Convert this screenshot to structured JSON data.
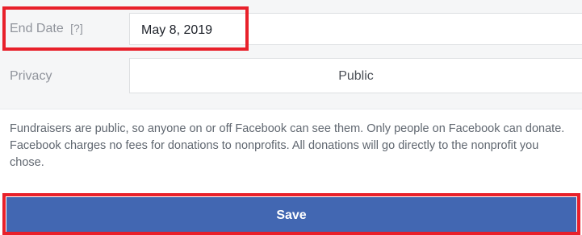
{
  "form": {
    "end_date": {
      "label": "End Date",
      "help": "[?]",
      "value": "May 8, 2019"
    },
    "privacy": {
      "label": "Privacy",
      "value": "Public"
    }
  },
  "info_text": "Fundraisers are public, so anyone on or off Facebook can see them. Only people on Facebook can donate. Facebook charges no fees for donations to nonprofits. All donations will go directly to the nonprofit you chose.",
  "save_label": "Save",
  "colors": {
    "primary": "#4267b2",
    "highlight": "#e8202a",
    "panel_bg": "#f5f6f7"
  }
}
